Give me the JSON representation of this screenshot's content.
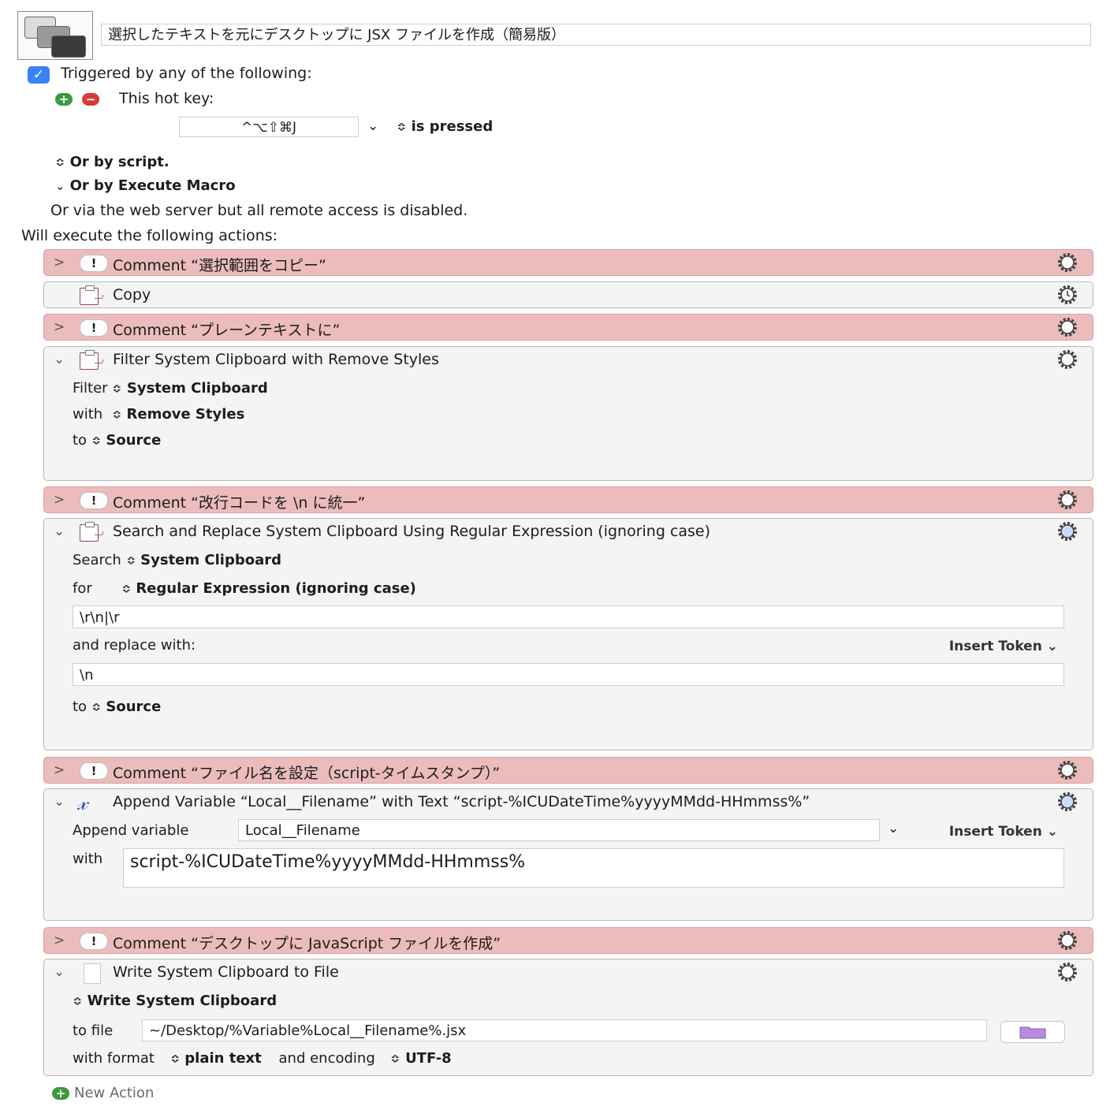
{
  "macro": {
    "name": "選択したテキストを元にデスクトップに JSX ファイルを作成（簡易版）",
    "icon": "keyboard-maestro-windows-icon"
  },
  "triggers": {
    "checkbox_label": "Triggered by any of the following:",
    "checked": true,
    "hotkey_label": "This hot key:",
    "hotkey_value": "^⌥⇧⌘J",
    "hotkey_state": "is pressed",
    "or_by_script": "Or by script.",
    "or_by_execute": "Or by Execute Macro",
    "web_server_note": "Or via the web server but all remote access is disabled."
  },
  "actions_label": "Will execute the following actions:",
  "actions": {
    "c1": {
      "title": "Comment “選択範囲をコピー”"
    },
    "copy": {
      "title": "Copy"
    },
    "c2": {
      "title": "Comment “プレーンテキストに”"
    },
    "filter": {
      "title": "Filter System Clipboard with Remove Styles",
      "filter_label": "Filter",
      "filter_value": "System Clipboard",
      "with_label": "with",
      "with_value": "Remove Styles",
      "to_label": "to",
      "to_value": "Source"
    },
    "c3": {
      "title": "Comment “改行コードを \\n に統一”"
    },
    "search": {
      "title": "Search and Replace System Clipboard Using Regular Expression (ignoring case)",
      "search_label": "Search",
      "search_value": "System Clipboard",
      "for_label": "for",
      "for_value": "Regular Expression (ignoring case)",
      "pattern": "\\r\\n|\\r",
      "replace_label": "and replace with:",
      "insert_token": "Insert Token",
      "replacement": "\\n",
      "to_label": "to",
      "to_value": "Source"
    },
    "c4": {
      "title": "Comment “ファイル名を設定（script-タイムスタンプ）”"
    },
    "append": {
      "title": "Append Variable “Local__Filename” with Text “script-%ICUDateTime%yyyyMMdd-HHmmss%”",
      "var_label": "Append variable",
      "var_value": "Local__Filename",
      "insert_token": "Insert Token",
      "with_label": "with",
      "with_value": "script-%ICUDateTime%yyyyMMdd-HHmmss%"
    },
    "c5": {
      "title": "Comment “デスクトップに JavaScript ファイルを作成”"
    },
    "write": {
      "title": "Write System Clipboard to File",
      "source_value": "Write System Clipboard",
      "file_label": "to file",
      "file_value": "~/Desktop/%Variable%Local__Filename%.jsx",
      "format_label": "with format",
      "format_value": "plain text",
      "encoding_label": "and encoding",
      "encoding_value": "UTF-8"
    }
  },
  "new_action": "New Action",
  "colors": {
    "comment_bg": "#ecbcbc",
    "action_bg": "#f4f4f4",
    "accent_blue": "#3a82f6",
    "add_green": "#3c9a3c",
    "remove_red": "#d83a3a"
  }
}
